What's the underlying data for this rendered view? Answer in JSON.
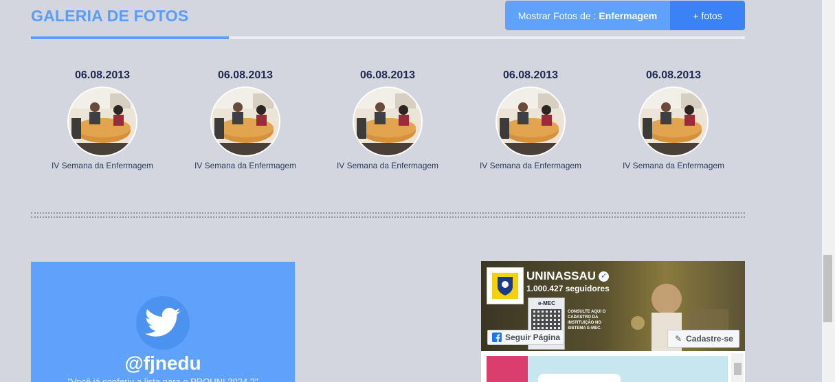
{
  "gallery": {
    "title": "GALERIA DE FOTOS",
    "filter_prefix": "Mostrar Fotos de :",
    "filter_value": "Enfermagem",
    "more_label": "+ fotos",
    "photos": [
      {
        "date": "06.08.2013",
        "caption": "IV Semana da Enfermagem"
      },
      {
        "date": "06.08.2013",
        "caption": "IV Semana da Enfermagem"
      },
      {
        "date": "06.08.2013",
        "caption": "IV Semana da Enfermagem"
      },
      {
        "date": "06.08.2013",
        "caption": "IV Semana da Enfermagem"
      },
      {
        "date": "06.08.2013",
        "caption": "IV Semana da Enfermagem"
      }
    ]
  },
  "twitter": {
    "handle": "@fjnedu",
    "tweet": "\"Você já conferiu a lista para o PROUNI 2024.2\""
  },
  "facebook": {
    "page_name": "UNINASSAU",
    "followers": "1.000.427 seguidores",
    "follow_label": "Seguir Página",
    "signup_label": "Cadastre-se",
    "emec_label": "e-MEC",
    "cover_text": "CONSULTE AQUI O CADASTRO DA INSTITUIÇÃO NO SISTEMA E-MEC."
  },
  "colors": {
    "accent": "#5b9df6",
    "filter_left": "#5ea2fb",
    "filter_right": "#3b82f6",
    "twitter_card": "#5ea2fb",
    "background": "#d3d6de"
  },
  "icons": [
    "twitter-bird-icon",
    "facebook-icon",
    "verified-icon",
    "pencil-icon"
  ]
}
